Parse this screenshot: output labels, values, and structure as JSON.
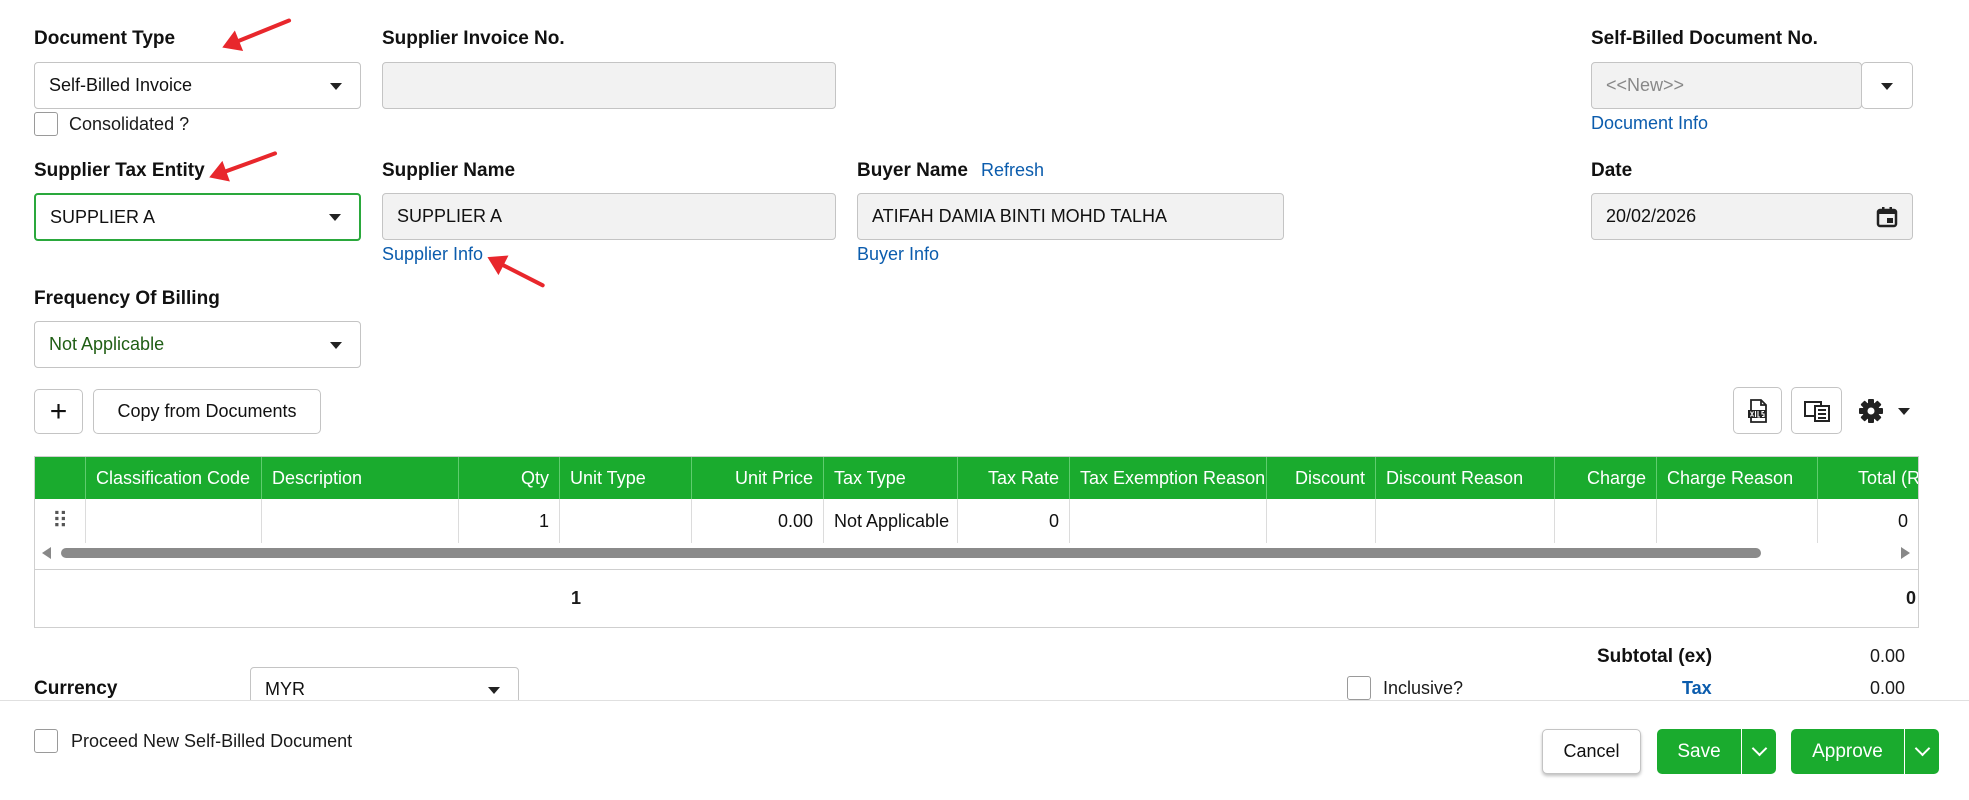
{
  "header": {
    "document_type": {
      "label": "Document Type",
      "value": "Self-Billed Invoice"
    },
    "consolidated_label": "Consolidated ?",
    "supplier_invoice_no": {
      "label": "Supplier Invoice No.",
      "value": ""
    },
    "self_billed_doc_no": {
      "label": "Self-Billed Document No.",
      "placeholder": "<<New>>"
    },
    "document_info_link": "Document Info",
    "supplier_tax_entity": {
      "label": "Supplier Tax Entity",
      "value": "SUPPLIER A"
    },
    "supplier_name": {
      "label": "Supplier Name",
      "value": "SUPPLIER A"
    },
    "supplier_info_link": "Supplier Info",
    "buyer_name": {
      "label": "Buyer Name",
      "refresh_link": "Refresh",
      "value": "ATIFAH DAMIA BINTI MOHD TALHA"
    },
    "buyer_info_link": "Buyer Info",
    "date": {
      "label": "Date",
      "value": "20/02/2026"
    },
    "frequency_of_billing": {
      "label": "Frequency Of Billing",
      "value": "Not Applicable"
    }
  },
  "toolbar": {
    "add_label": "+",
    "copy_from_documents_label": "Copy from Documents"
  },
  "table": {
    "columns": [
      "Classification Code",
      "Description",
      "Qty",
      "Unit Type",
      "Unit Price",
      "Tax Type",
      "Tax Rate",
      "Tax Exemption Reason",
      "Discount",
      "Discount Reason",
      "Charge",
      "Charge Reason",
      "Total (R"
    ],
    "rows": [
      {
        "classification_code": "",
        "description": "",
        "qty": "1",
        "unit_type": "",
        "unit_price": "0.00",
        "tax_type": "Not Applicable",
        "tax_rate": "0",
        "tax_exemption_reason": "",
        "discount": "",
        "discount_reason": "",
        "charge": "",
        "charge_reason": "",
        "total": "0"
      }
    ],
    "footer": {
      "qty_total": "1",
      "grand_total": "0"
    }
  },
  "currency": {
    "label": "Currency",
    "value": "MYR"
  },
  "inclusive_label": "Inclusive?",
  "totals": {
    "subtotal_label": "Subtotal (ex)",
    "subtotal_value": "0.00",
    "tax_label": "Tax",
    "tax_value": "0.00"
  },
  "footer": {
    "proceed_label": "Proceed New Self-Billed Document",
    "cancel_label": "Cancel",
    "save_label": "Save",
    "approve_label": "Approve"
  },
  "colors": {
    "accent_green": "#1aab2e",
    "link_blue": "#0b5cad",
    "annotation_red": "#e8272c"
  },
  "icons": [
    "caret-down-icon",
    "calendar-icon",
    "plus-icon",
    "excel-export-icon",
    "column-layout-icon",
    "gear-icon",
    "drag-handle-icon",
    "chevron-down-icon"
  ]
}
